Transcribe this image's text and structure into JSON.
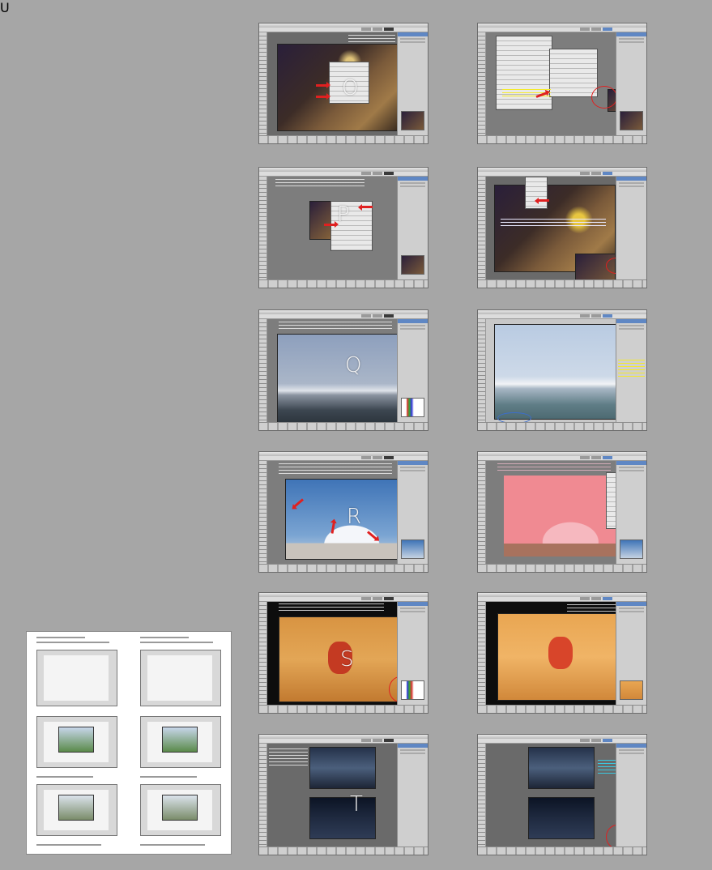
{
  "letters": {
    "p1": "O",
    "p2": "P",
    "p3": "Q",
    "p4": "R",
    "p5": "S",
    "p6": "T",
    "doc": "U"
  },
  "colors": {
    "page_bg": "#a6a6a6",
    "workspace": "#7d7d7d",
    "panel_tab": "#5f87c4",
    "annotation_red": "#e02020",
    "annotation_yellow": "#f4ea2a"
  }
}
